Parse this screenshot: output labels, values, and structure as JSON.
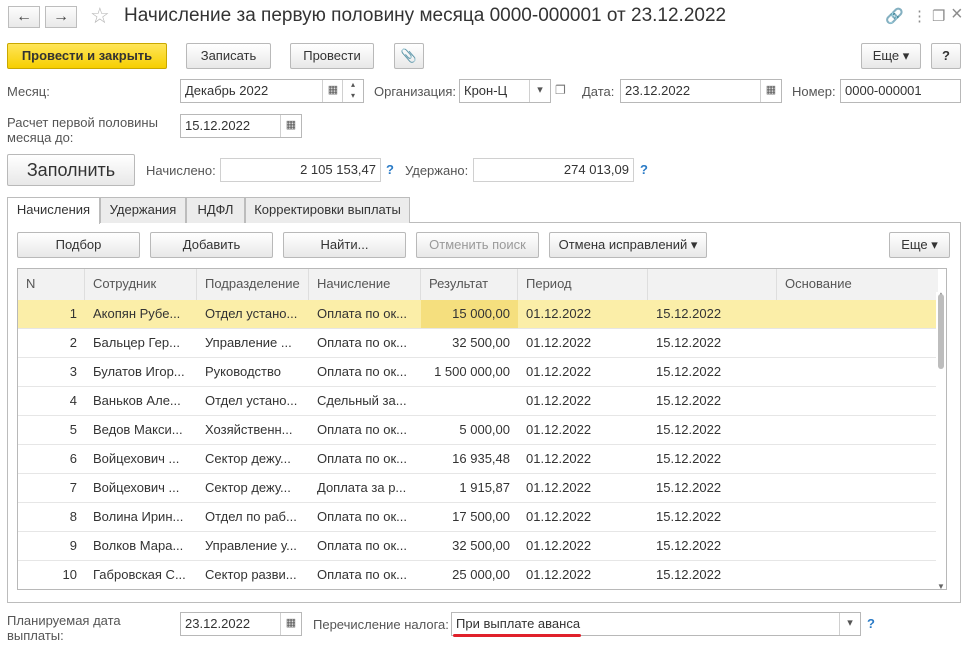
{
  "window": {
    "title": "Начисление за первую половину месяца 0000-000001 от 23.12.2022",
    "back_icon": "←",
    "forward_icon": "→",
    "star_icon": "☆",
    "link_icon": "🔗",
    "more_icon": "⋮",
    "restore_icon": "❐",
    "close_icon": "×"
  },
  "toolbar": {
    "post_close": "Провести и закрыть",
    "save": "Записать",
    "post": "Провести",
    "attach_icon": "📎",
    "more": "Еще ▾",
    "help": "?"
  },
  "form": {
    "month_label": "Месяц:",
    "month_value": "Декабрь 2022",
    "org_label": "Организация:",
    "org_value": "Крон-Ц",
    "date_label": "Дата:",
    "date_value": "23.12.2022",
    "number_label": "Номер:",
    "number_value": "0000-000001",
    "calc_label_1": "Расчет первой половины",
    "calc_label_2": "месяца до:",
    "calc_value": "15.12.2022",
    "fill_button": "Заполнить",
    "accrued_label": "Начислено:",
    "accrued_value": "2 105 153,47",
    "withheld_label": "Удержано:",
    "withheld_value": "274 013,09",
    "help_mark": "?"
  },
  "tabs": [
    "Начисления",
    "Удержания",
    "НДФЛ",
    "Корректировки выплаты"
  ],
  "table_toolbar": {
    "select": "Подбор",
    "add": "Добавить",
    "find": "Найти...",
    "cancel_search": "Отменить поиск",
    "cancel_fixes": "Отмена исправлений ▾",
    "more": "Еще ▾"
  },
  "table": {
    "headers": [
      "N",
      "Сотрудник",
      "Подразделение",
      "Начисление",
      "Результат",
      "Период",
      "",
      "Основание"
    ],
    "rows": [
      {
        "n": "1",
        "employee": "Акопян Рубе...",
        "dept": "Отдел устано...",
        "accrual": "Оплата по ок...",
        "result": "15 000,00",
        "from": "01.12.2022",
        "to": "15.12.2022",
        "basis": ""
      },
      {
        "n": "2",
        "employee": "Бальцер Гер...",
        "dept": "Управление ...",
        "accrual": "Оплата по ок...",
        "result": "32 500,00",
        "from": "01.12.2022",
        "to": "15.12.2022",
        "basis": ""
      },
      {
        "n": "3",
        "employee": "Булатов Игор...",
        "dept": "Руководство",
        "accrual": "Оплата по ок...",
        "result": "1 500 000,00",
        "from": "01.12.2022",
        "to": "15.12.2022",
        "basis": ""
      },
      {
        "n": "4",
        "employee": "Ваньков Але...",
        "dept": "Отдел устано...",
        "accrual": "Сдельный за...",
        "result": "",
        "from": "01.12.2022",
        "to": "15.12.2022",
        "basis": ""
      },
      {
        "n": "5",
        "employee": "Ведов Макси...",
        "dept": "Хозяйственн...",
        "accrual": "Оплата по ок...",
        "result": "5 000,00",
        "from": "01.12.2022",
        "to": "15.12.2022",
        "basis": ""
      },
      {
        "n": "6",
        "employee": "Войцехович ...",
        "dept": "Сектор дежу...",
        "accrual": "Оплата по ок...",
        "result": "16 935,48",
        "from": "01.12.2022",
        "to": "15.12.2022",
        "basis": ""
      },
      {
        "n": "7",
        "employee": "Войцехович ...",
        "dept": "Сектор дежу...",
        "accrual": "Доплата за р...",
        "result": "1 915,87",
        "from": "01.12.2022",
        "to": "15.12.2022",
        "basis": ""
      },
      {
        "n": "8",
        "employee": "Волина Ирин...",
        "dept": "Отдел по раб...",
        "accrual": "Оплата по ок...",
        "result": "17 500,00",
        "from": "01.12.2022",
        "to": "15.12.2022",
        "basis": ""
      },
      {
        "n": "9",
        "employee": "Волков Мара...",
        "dept": "Управление у...",
        "accrual": "Оплата по ок...",
        "result": "32 500,00",
        "from": "01.12.2022",
        "to": "15.12.2022",
        "basis": ""
      },
      {
        "n": "10",
        "employee": "Габровская С...",
        "dept": "Сектор разви...",
        "accrual": "Оплата по ок...",
        "result": "25 000,00",
        "from": "01.12.2022",
        "to": "15.12.2022",
        "basis": ""
      }
    ]
  },
  "footer": {
    "pay_date_label_1": "Планируемая дата",
    "pay_date_label_2": "выплаты:",
    "pay_date_value": "23.12.2022",
    "tax_label": "Перечисление налога:",
    "tax_value": "При выплате аванса",
    "help_mark": "?"
  },
  "colors": {
    "accent": "#f6cf00",
    "selected_row": "#fbeea8",
    "underline": "#e0202a",
    "help": "#2b7bc6"
  }
}
